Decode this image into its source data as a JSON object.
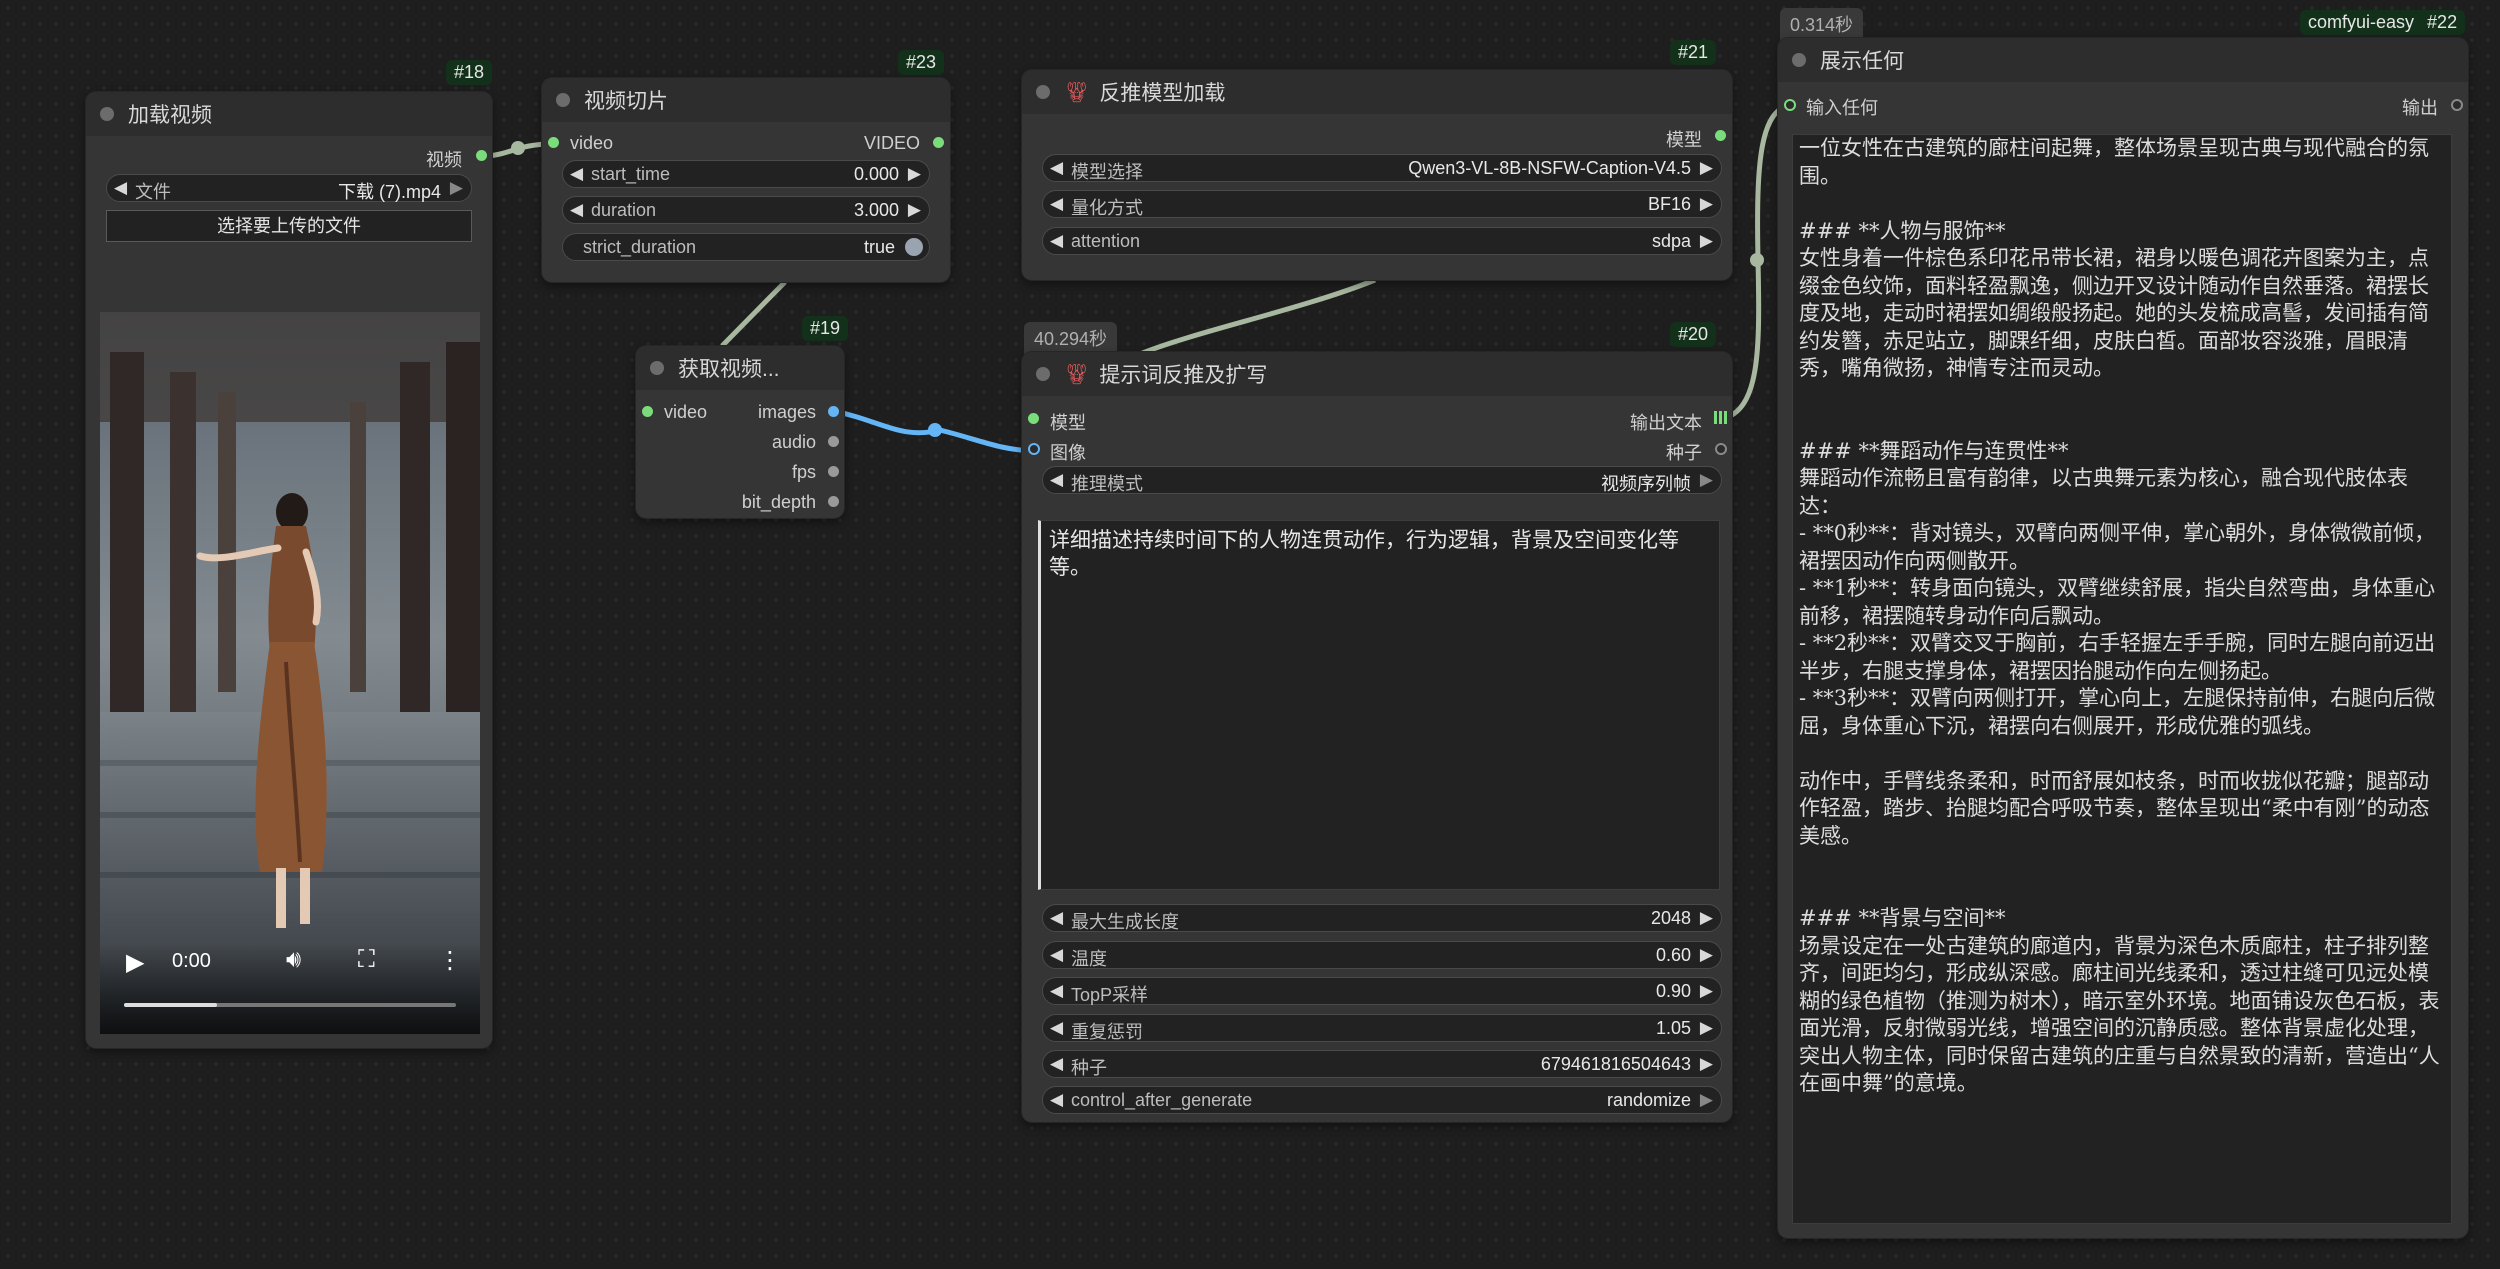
{
  "nodes": {
    "load_video": {
      "badge": "#18",
      "title": "加载视频",
      "output_label": "视频",
      "file_label": "文件",
      "file_value": "下载 (7).mp4",
      "upload_button": "选择要上传的文件",
      "player": {
        "time": "0:00",
        "progress": 0.28
      }
    },
    "video_slice": {
      "badge": "#23",
      "title": "视频切片",
      "input_label": "video",
      "output_label": "VIDEO",
      "widgets": [
        {
          "label": "start_time",
          "value": "0.000"
        },
        {
          "label": "duration",
          "value": "3.000"
        }
      ],
      "toggle": {
        "label": "strict_duration",
        "value": "true"
      }
    },
    "get_video": {
      "badge": "#19",
      "title": "获取视频...",
      "input_label": "video",
      "outputs": [
        "images",
        "audio",
        "fps",
        "bit_depth"
      ]
    },
    "model_loader": {
      "badge": "#21",
      "title": "反推模型加载",
      "output_label": "模型",
      "widgets": [
        {
          "label": "模型选择",
          "value": "Qwen3-VL-8B-NSFW-Caption-V4.5"
        },
        {
          "label": "量化方式",
          "value": "BF16"
        },
        {
          "label": "attention",
          "value": "sdpa"
        }
      ]
    },
    "prompt_node": {
      "timer": "40.294秒",
      "badge": "#20",
      "title": "提示词反推及扩写",
      "inputs": [
        "模型",
        "图像"
      ],
      "outputs": [
        "输出文本",
        "种子"
      ],
      "mode_label": "推理模式",
      "mode_value": "视频序列帧",
      "prompt_text": "详细描述持续时间下的人物连贯动作，行为逻辑，背景及空间变化等等。",
      "widgets": [
        {
          "label": "最大生成长度",
          "value": "2048"
        },
        {
          "label": "温度",
          "value": "0.60"
        },
        {
          "label": "TopP采样",
          "value": "0.90"
        },
        {
          "label": "重复惩罚",
          "value": "1.05"
        },
        {
          "label": "种子",
          "value": "679461816504643"
        },
        {
          "label": "control_after_generate",
          "value": "randomize"
        }
      ]
    },
    "show_any": {
      "timer": "0.314秒",
      "badge_name": "comfyui-easy",
      "badge": "#22",
      "title": "展示任何",
      "input_label": "输入任何",
      "output_label": "输出",
      "text": "一位女性在古建筑的廊柱间起舞，整体场景呈现古典与现代融合的氛围。\n\n### **人物与服饰**\n女性身着一件棕色系印花吊带长裙，裙身以暖色调花卉图案为主，点缀金色纹饰，面料轻盈飘逸，侧边开叉设计随动作自然垂落。裙摆长度及地，走动时裙摆如绸缎般扬起。她的头发梳成高髻，发间插有简约发簪，赤足站立，脚踝纤细，皮肤白皙。面部妆容淡雅，眉眼清秀，嘴角微扬，神情专注而灵动。\n\n\n### **舞蹈动作与连贯性**\n舞蹈动作流畅且富有韵律，以古典舞元素为核心，融合现代肢体表达：\n- **0秒**：背对镜头，双臂向两侧平伸，掌心朝外，身体微微前倾，裙摆因动作向两侧散开。\n- **1秒**：转身面向镜头，双臂继续舒展，指尖自然弯曲，身体重心前移，裙摆随转身动作向后飘动。\n- **2秒**：双臂交叉于胸前，右手轻握左手手腕，同时左腿向前迈出半步，右腿支撑身体，裙摆因抬腿动作向左侧扬起。\n- **3秒**：双臂向两侧打开，掌心向上，左腿保持前伸，右腿向后微屈，身体重心下沉，裙摆向右侧展开，形成优雅的弧线。\n\n动作中，手臂线条柔和，时而舒展如枝条，时而收拢似花瓣；腿部动作轻盈，踏步、抬腿均配合呼吸节奏，整体呈现出“柔中有刚”的动态美感。\n\n\n### **背景与空间**\n场景设定在一处古建筑的廊道内，背景为深色木质廊柱，柱子排列整齐，间距均匀，形成纵深感。廊柱间光线柔和，透过柱缝可见远处模糊的绿色植物（推测为树木），暗示室外环境。地面铺设灰色石板，表面光滑，反射微弱光线，增强空间的沉静质感。整体背景虚化处理，突出人物主体，同时保留古建筑的庄重与自然景致的清新，营造出“人在画中舞”的意境。"
    }
  },
  "colors": {
    "canvas": "#1e1e1e",
    "node_body": "#353535",
    "node_title": "#2d2d2d",
    "badge_bg": "#13311a",
    "link_green": "#a8b8a0",
    "link_blue": "#64b5f6"
  },
  "icons": [
    "node-status-dot",
    "lobster-icon",
    "play-icon",
    "volume-icon",
    "fullscreen-icon",
    "more-icon"
  ]
}
